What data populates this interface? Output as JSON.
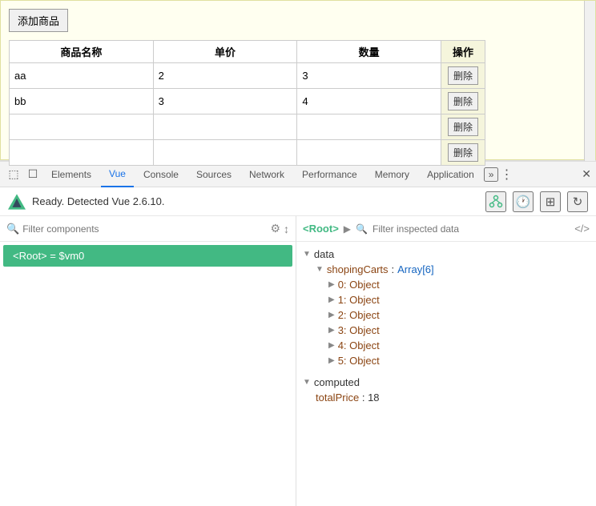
{
  "app": {
    "add_button_label": "添加商品",
    "table": {
      "headers": [
        "商品名称",
        "单价",
        "数量",
        "操作"
      ],
      "rows": [
        {
          "name": "aa",
          "price": "2",
          "qty": "3",
          "action": "删除"
        },
        {
          "name": "bb",
          "price": "3",
          "qty": "4",
          "action": "删除"
        },
        {
          "name": "",
          "price": "",
          "qty": "",
          "action": "删除"
        },
        {
          "name": "",
          "price": "",
          "qty": "",
          "action": "删除"
        }
      ]
    }
  },
  "devtools": {
    "tabs": [
      "Elements",
      "Vue",
      "Console",
      "Sources",
      "Network",
      "Performance",
      "Memory",
      "Application"
    ],
    "active_tab": "Vue",
    "status": "Ready. Detected Vue 2.6.10.",
    "filter_placeholder": "Filter components",
    "component_label": "<Root> = $vm0",
    "right_header": {
      "root_tag": "<Root>",
      "filter_placeholder": "Filter inspected data"
    },
    "data_tree": {
      "section_data": "data",
      "shopping_carts": {
        "label": "shopingCarts",
        "type": "Array[6]",
        "items": [
          "0: Object",
          "1: Object",
          "2: Object",
          "3: Object",
          "4: Object",
          "5: Object"
        ]
      },
      "section_computed": "computed",
      "total_price": {
        "label": "totalPrice",
        "value": "18"
      }
    }
  }
}
